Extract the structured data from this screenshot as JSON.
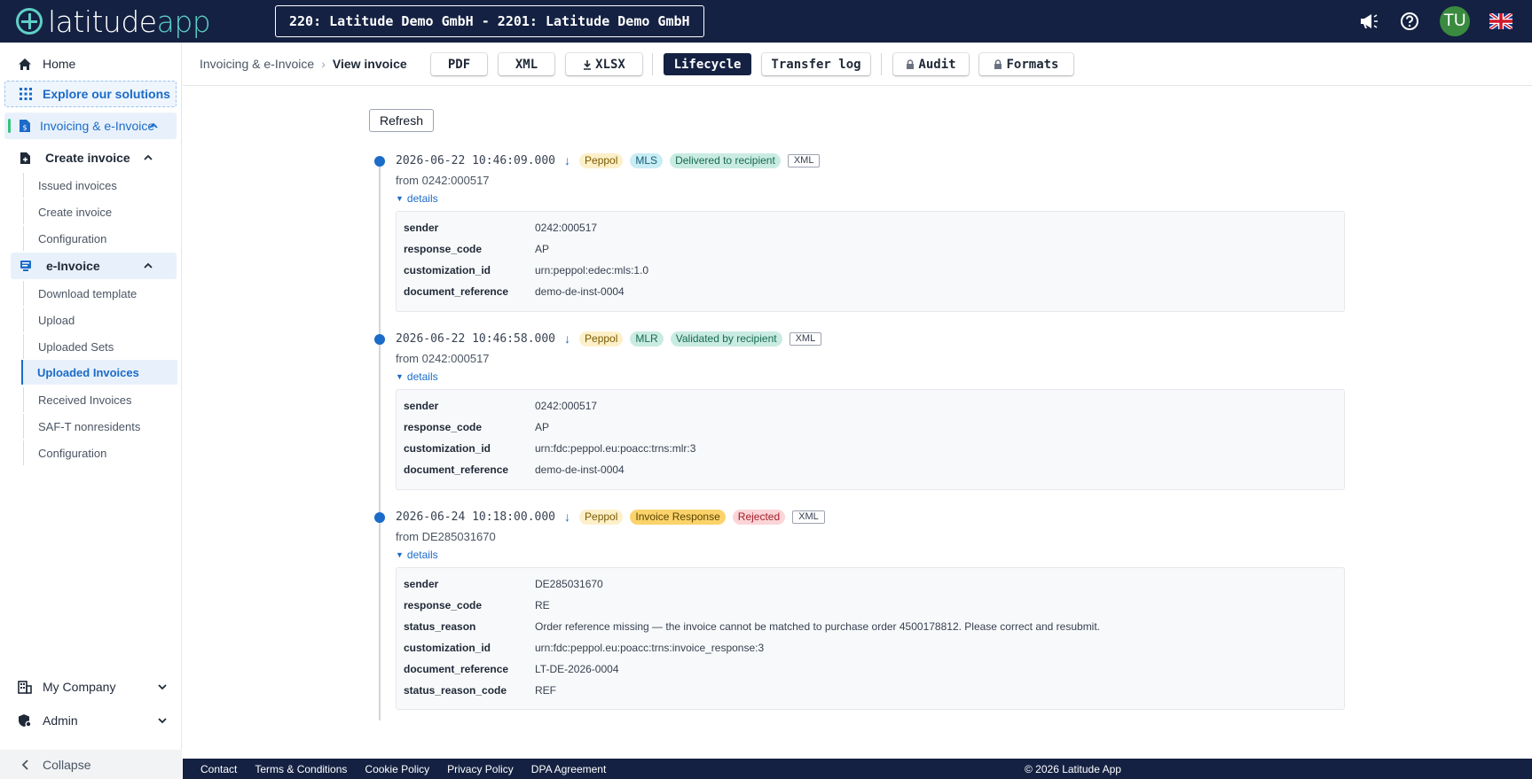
{
  "app": {
    "brand_main": "latitude",
    "brand_accent": "app",
    "tenant": "220: Latitude Demo GmbH - 2201: Latitude Demo GmbH",
    "avatar_initials": "TU",
    "accent_color": "#1b6bc8",
    "brand_color": "#142142"
  },
  "topbar_icons": [
    "megaphone-icon",
    "help-icon",
    "avatar",
    "uk-flag-icon"
  ],
  "sidebar": {
    "home": "Home",
    "explore": "Explore our solutions",
    "invoicing": "Invoicing & e-Invoice",
    "create_invoice_group": "Create invoice",
    "create_invoice_items": [
      "Issued invoices",
      "Create invoice",
      "Configuration"
    ],
    "einvoice_group": "e-Invoice",
    "einvoice_items": [
      "Download template",
      "Upload",
      "Uploaded Sets",
      "Uploaded Invoices",
      "Received Invoices",
      "SAF-T nonresidents",
      "Configuration"
    ],
    "active_item": "Uploaded Invoices",
    "my_company": "My Company",
    "admin": "Admin",
    "collapse": "Collapse"
  },
  "breadcrumb": {
    "parent": "Invoicing & e-Invoice",
    "current": "View invoice"
  },
  "toolbar": {
    "pdf": "PDF",
    "xml": "XML",
    "xlsx": "XLSX",
    "lifecycle": "Lifecycle",
    "transfer_log": "Transfer log",
    "audit": "Audit",
    "formats": "Formats"
  },
  "refresh_label": "Refresh",
  "details_label": "details",
  "events": [
    {
      "timestamp": "2026-06-22 10:46:09.000",
      "direction": "↓",
      "network": "Peppol",
      "type": "MLS",
      "status": "Delivered to recipient",
      "format": "XML",
      "from": "from 0242:000517",
      "fields": [
        {
          "key": "sender",
          "value": "0242:000517"
        },
        {
          "key": "response_code",
          "value": "AP"
        },
        {
          "key": "customization_id",
          "value": "urn:peppol:edec:mls:1.0"
        },
        {
          "key": "document_reference",
          "value": "demo-de-inst-0004"
        }
      ]
    },
    {
      "timestamp": "2026-06-22 10:46:58.000",
      "direction": "↓",
      "network": "Peppol",
      "type": "MLR",
      "status": "Validated by recipient",
      "format": "XML",
      "from": "from 0242:000517",
      "fields": [
        {
          "key": "sender",
          "value": "0242:000517"
        },
        {
          "key": "response_code",
          "value": "AP"
        },
        {
          "key": "customization_id",
          "value": "urn:fdc:peppol.eu:poacc:trns:mlr:3"
        },
        {
          "key": "document_reference",
          "value": "demo-de-inst-0004"
        }
      ]
    },
    {
      "timestamp": "2026-06-24 10:18:00.000",
      "direction": "↓",
      "network": "Peppol",
      "type": "Invoice Response",
      "status": "Rejected",
      "format": "XML",
      "from": "from DE285031670",
      "fields": [
        {
          "key": "sender",
          "value": "DE285031670"
        },
        {
          "key": "response_code",
          "value": "RE"
        },
        {
          "key": "status_reason",
          "value": "Order reference missing — the invoice cannot be matched to purchase order 4500178812. Please correct and resubmit."
        },
        {
          "key": "customization_id",
          "value": "urn:fdc:peppol.eu:poacc:trns:invoice_response:3"
        },
        {
          "key": "document_reference",
          "value": "LT-DE-2026-0004"
        },
        {
          "key": "status_reason_code",
          "value": "REF"
        }
      ]
    }
  ],
  "footer": {
    "links": [
      "Contact",
      "Terms & Conditions",
      "Cookie Policy",
      "Privacy Policy",
      "DPA Agreement"
    ],
    "copyright": "© 2026 Latitude App"
  }
}
